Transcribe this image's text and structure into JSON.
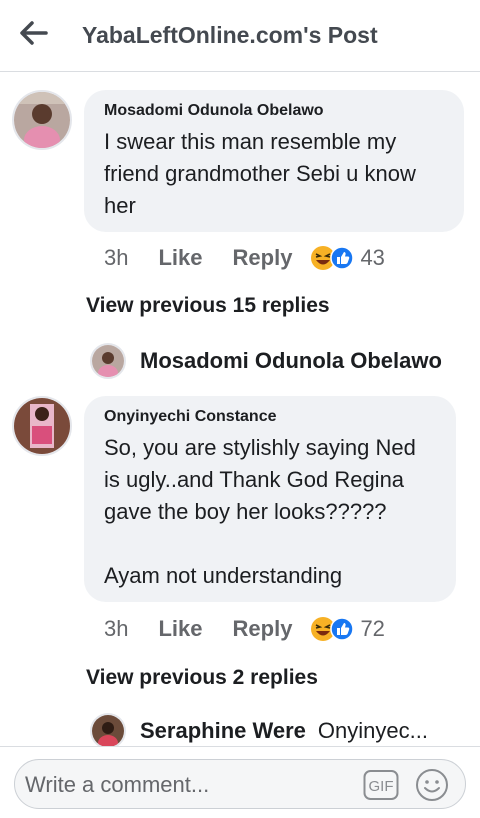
{
  "header": {
    "title": "YabaLeftOnline.com's Post"
  },
  "comments": [
    {
      "author": "Mosadomi Odunola Obelawo",
      "text": "I swear this man resemble my\nfriend grandmother Sebi u know\nher",
      "time": "3h",
      "like_label": "Like",
      "reply_label": "Reply",
      "reaction_count": "43",
      "reactions": [
        "haha-icon",
        "like-icon"
      ],
      "view_previous": "View previous 15 replies",
      "reply_preview": {
        "name": "Mosadomi Odunola Obelawo",
        "snippet": ""
      }
    },
    {
      "author": "Onyinyechi Constance",
      "text": "So, you are stylishly saying Ned\nis ugly..and Thank God Regina\ngave the boy her looks?????\n\nAyam not understanding",
      "time": "3h",
      "like_label": "Like",
      "reply_label": "Reply",
      "reaction_count": "72",
      "reactions": [
        "haha-icon",
        "like-icon"
      ],
      "view_previous": "View previous 2 replies",
      "reply_preview": {
        "name": "Seraphine Were",
        "snippet": "Onyinyec..."
      }
    }
  ],
  "composer": {
    "placeholder": "Write a comment...",
    "gif_label": "GIF"
  },
  "colors": {
    "bubble": "#f0f2f5",
    "secondary_text": "#65676b",
    "like_blue": "#1877f2",
    "haha_yellow": "#f7b125"
  }
}
